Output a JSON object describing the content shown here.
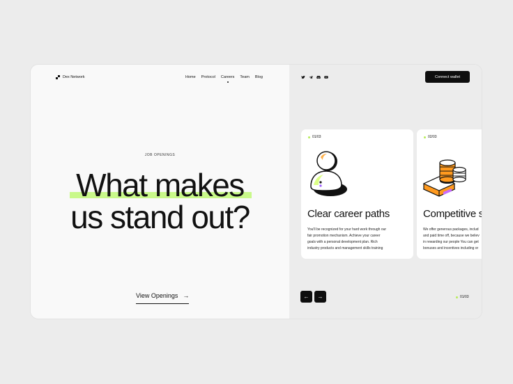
{
  "brand": {
    "name": "Dex Network"
  },
  "nav": [
    "Home",
    "Protocol",
    "Careers",
    "Team",
    "Blog"
  ],
  "nav_active": "Careers",
  "hero": {
    "label": "JOB OPENINGS",
    "headline_line1": "What makes",
    "headline_line2": "us stand out?",
    "cta": "View Openings",
    "cta_icon": "arrow-right-icon"
  },
  "socials": [
    "twitter-icon",
    "telegram-icon",
    "discord-icon",
    "youtube-icon"
  ],
  "connect_label": "Connect wallet",
  "cards": [
    {
      "num": "01/03",
      "title": "Clear career paths",
      "desc": [
        "You'll be recognized for your hard work through our",
        "fair promotion mechanism. Achieve your career",
        "goals with a personal development plan. Rich",
        "industry products and management skills training"
      ],
      "icon": "person-icon"
    },
    {
      "num": "02/03",
      "title": "Competitive s",
      "desc": [
        "We offer generous packages, includ",
        "and paid time off, because we believ",
        "in rewarding our people You can get",
        "bonuses and incentives including or"
      ],
      "icon": "coins-icon"
    }
  ],
  "pager": "01/03",
  "colors": {
    "accent": "#c9f98a",
    "dark": "#0e0e0e",
    "orange": "#ff9a1f",
    "purple": "#c86bff"
  }
}
